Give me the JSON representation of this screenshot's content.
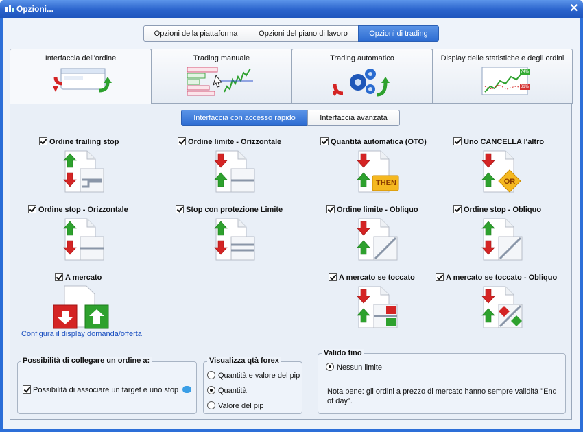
{
  "window": {
    "title": "Opzioni..."
  },
  "top_tabs": [
    {
      "label": "Opzioni della piattaforma",
      "active": false
    },
    {
      "label": "Opzioni del piano di lavoro",
      "active": false
    },
    {
      "label": "Opzioni di trading",
      "active": true
    }
  ],
  "picture_tabs": [
    {
      "label": "Interfaccia dell'ordine",
      "active": true
    },
    {
      "label": "Trading manuale",
      "active": false
    },
    {
      "label": "Trading automatico",
      "active": false
    },
    {
      "label": "Display delle statistiche e degli ordini",
      "active": false
    }
  ],
  "trading_manual_thumb": {
    "rows": [
      "Send limit buy 8",
      "Send stop sell",
      "Cancel buy",
      "Send stop sell 0",
      "Send trailing stop sell"
    ]
  },
  "stats_thumb": {
    "badge_top": "74%",
    "badge_bottom": "31%"
  },
  "sub_tabs": [
    {
      "label": "Interfaccia con accesso rapido",
      "active": true
    },
    {
      "label": "Interfaccia avanzata",
      "active": false
    }
  ],
  "options": {
    "trailing_stop": "Ordine trailing stop",
    "limit_horizontal": "Ordine limite - Orizzontale",
    "stop_horizontal": "Ordine stop - Orizzontale",
    "stop_limit": "Stop con protezione Limite",
    "market": "A mercato",
    "auto_qty": "Quantità automatica (OTO)",
    "oco": "Uno CANCELLA l'altro",
    "limit_oblique": "Ordine limite - Obliquo",
    "stop_oblique": "Ordine stop - Obliquo",
    "mit": "A mercato se toccato",
    "mit_oblique": "A mercato se toccato - Obliquo"
  },
  "badges": {
    "then": "THEN",
    "or": "OR"
  },
  "configure_link": "Configura il display domanda/offerta",
  "link_group": {
    "title": "Possibilità di collegare un ordine a:",
    "checkbox_label": "Possibilità di associare un target e uno stop"
  },
  "forex_group": {
    "title": "Visualizza qtà forex",
    "options": [
      {
        "label": "Quantità e valore del pip",
        "selected": false
      },
      {
        "label": "Quantità",
        "selected": true
      },
      {
        "label": "Valore del pip",
        "selected": false
      }
    ]
  },
  "valid_group": {
    "title": "Valido fino",
    "option": "Nessun limite",
    "note": "Nota bene: gli ordini a prezzo di mercato hanno sempre validità \"End of day\"."
  },
  "colors": {
    "titlebar": "#2a63cc",
    "active_tab": "#2d6cd2",
    "arrow_green": "#2ea12e",
    "arrow_red": "#d42424",
    "link": "#1a4fc0"
  }
}
